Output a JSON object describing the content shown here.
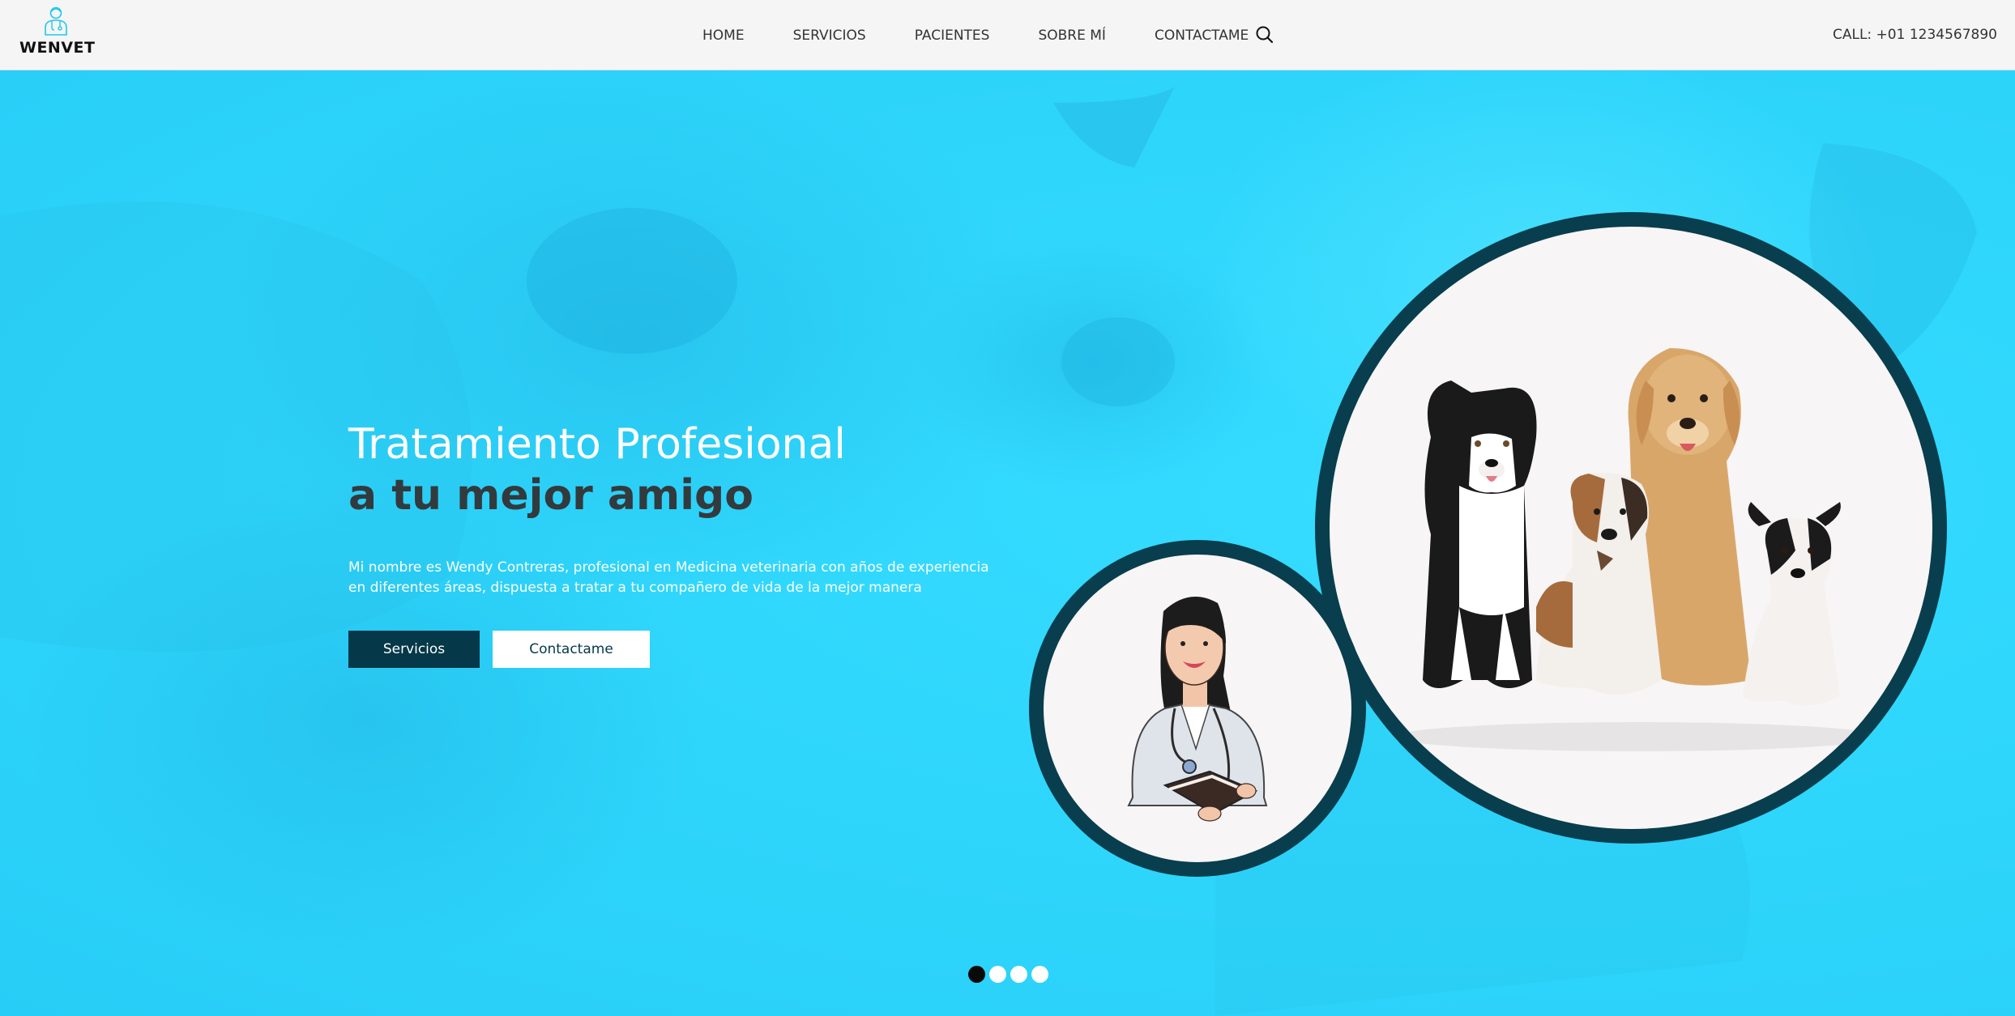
{
  "brand": {
    "name": "WENVET",
    "logo_icon": "vet-doctor-icon"
  },
  "nav": {
    "items": [
      {
        "label": "HOME"
      },
      {
        "label": "SERVICIOS"
      },
      {
        "label": "PACIENTES"
      },
      {
        "label": "SOBRE MÍ"
      },
      {
        "label": "CONTACTAME"
      }
    ],
    "search_icon": "search-icon"
  },
  "header": {
    "call": "CALL: +01 1234567890"
  },
  "hero": {
    "title_line1": "Tratamiento Profesional",
    "title_line2": "a tu mejor amigo",
    "description": "Mi nombre es Wendy Contreras, profesional en Medicina veterinaria con años de experiencia en diferentes áreas, dispuesta a tratar a tu compañero de vida de la mejor manera",
    "buttons": {
      "primary": "Servicios",
      "secondary": "Contactame"
    },
    "images": {
      "big": "dogs-group-image",
      "small": "veterinarian-illustration"
    }
  },
  "carousel": {
    "count": 4,
    "active_index": 0
  },
  "colors": {
    "hero_bg": "#2cd2f8",
    "dark_teal": "#053848",
    "header_bg": "#f4f5f4",
    "title_dark": "#333a3d"
  }
}
